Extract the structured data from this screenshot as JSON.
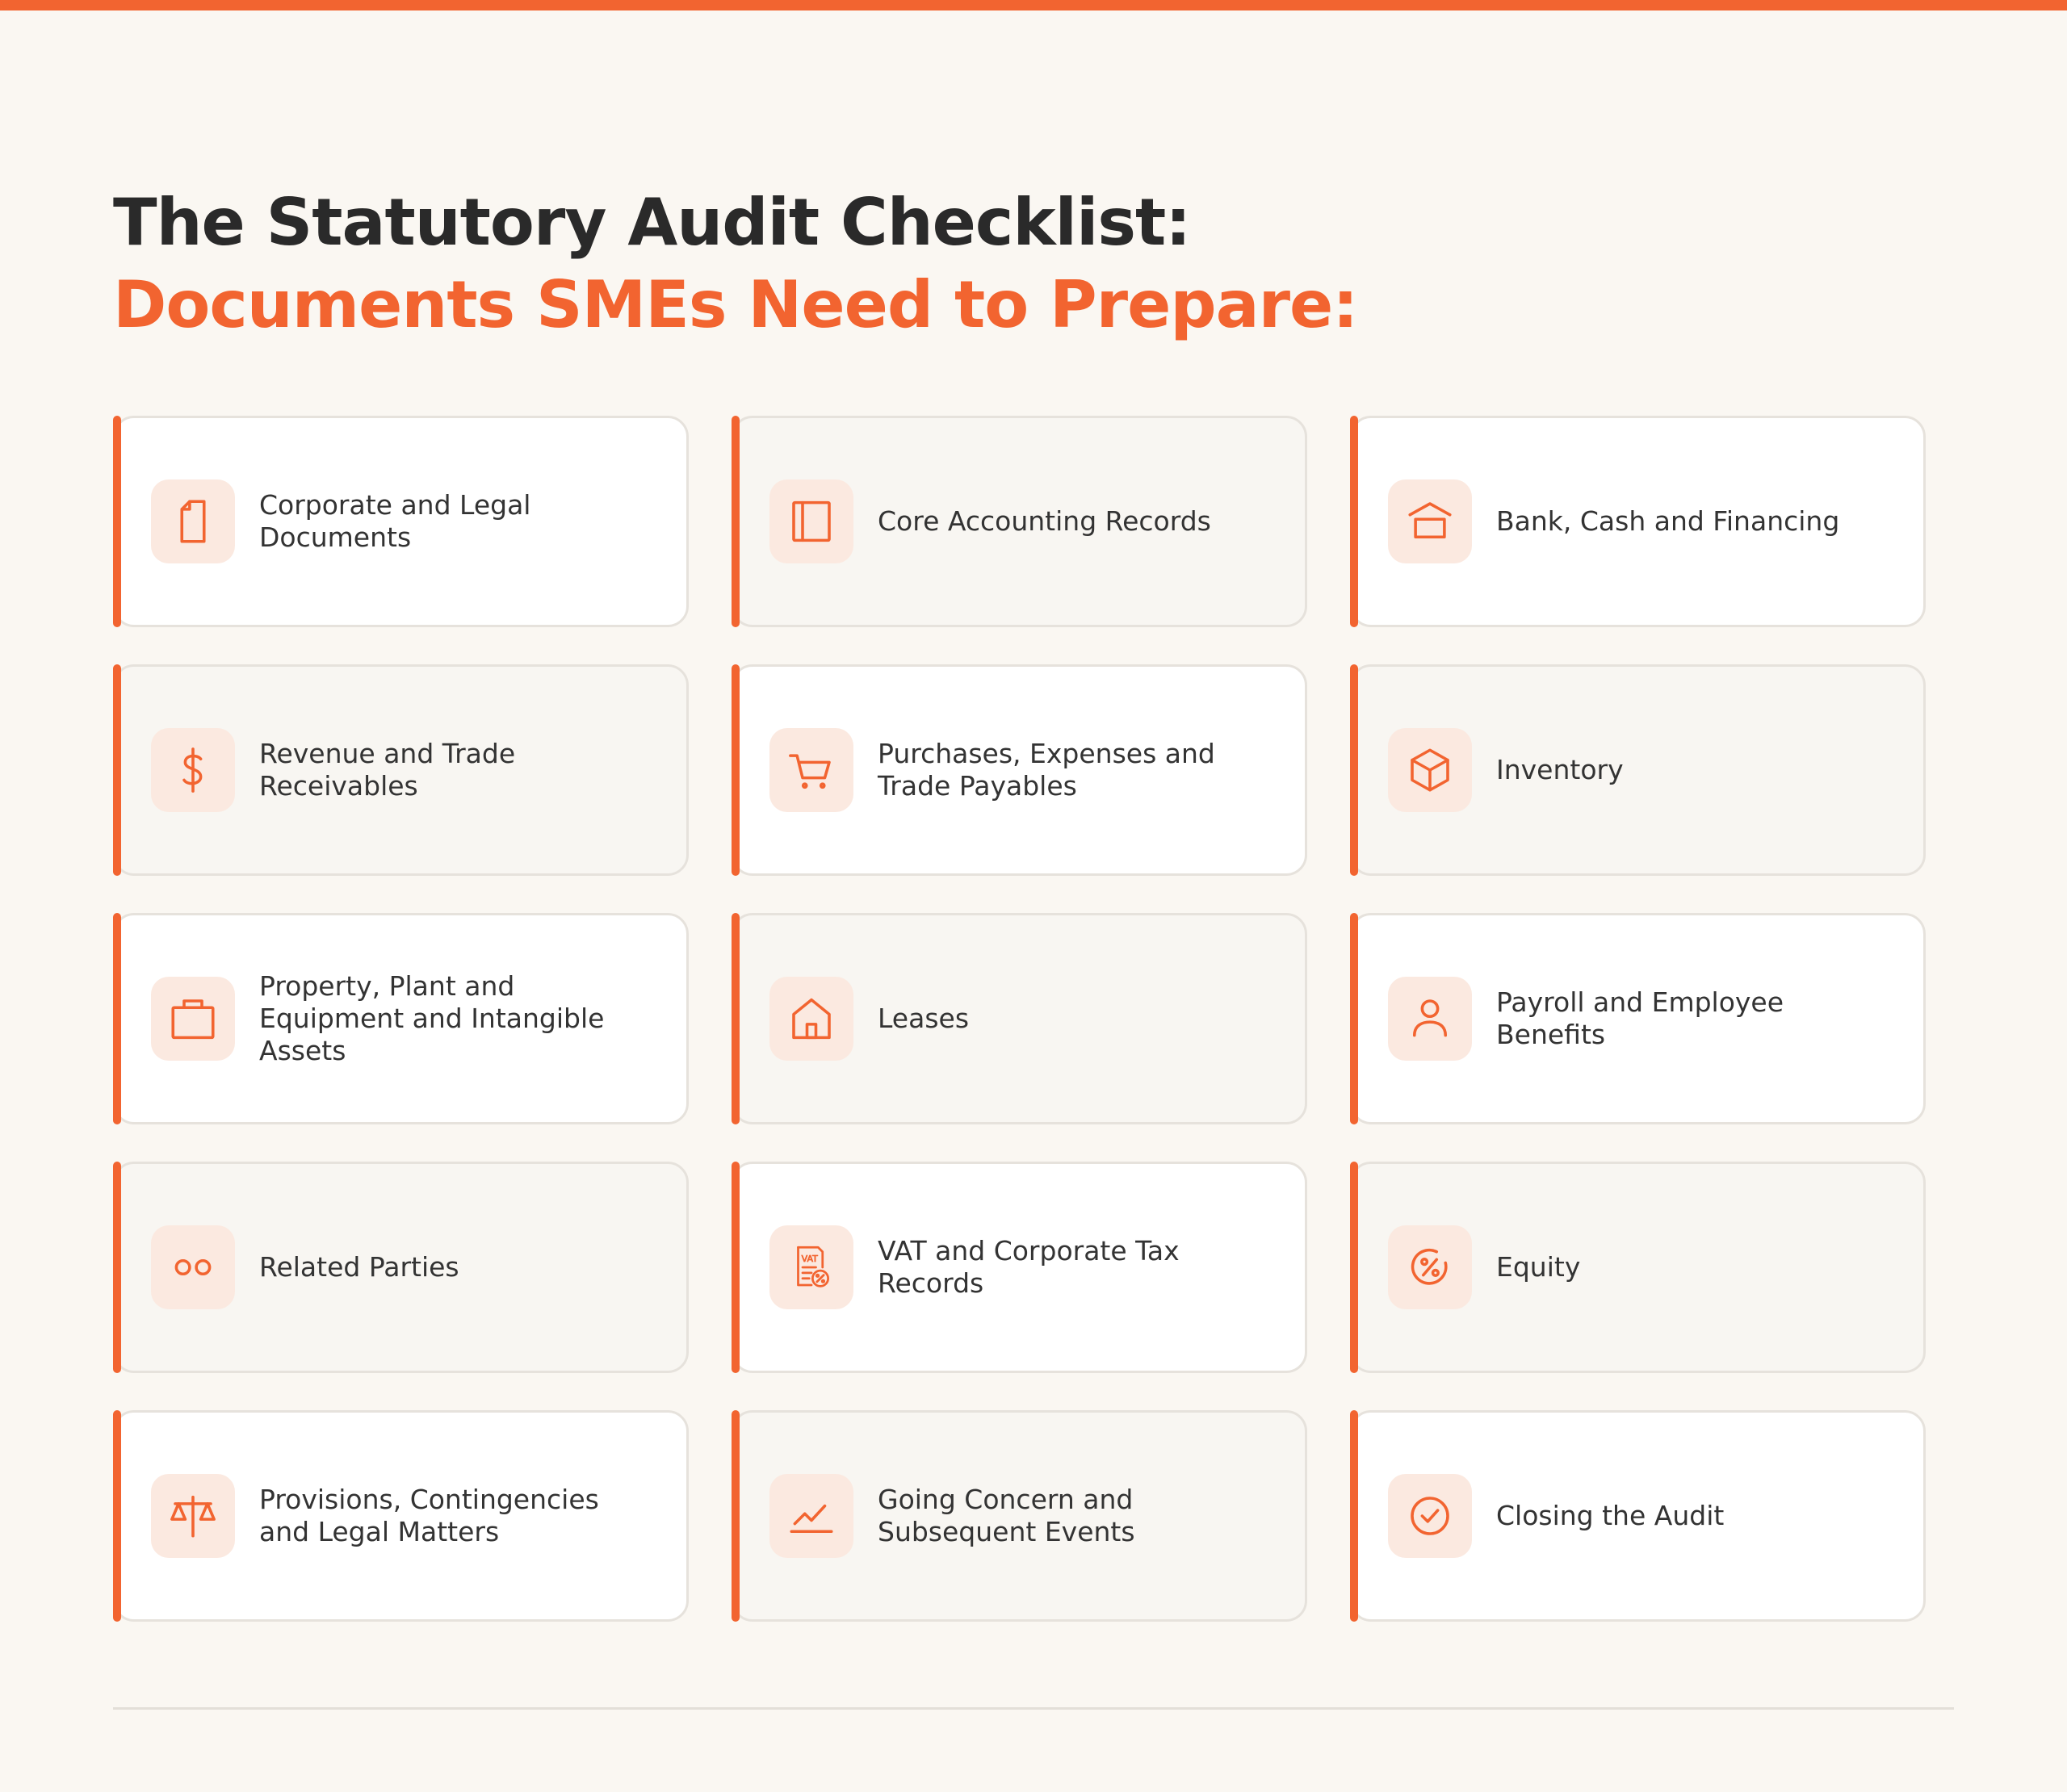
{
  "title": {
    "line1": "The Statutory Audit Checklist:",
    "line2": "Documents SMEs Need to Prepare:"
  },
  "accent_color": "#f26430",
  "cards": [
    {
      "label": "Corporate and Legal Documents",
      "icon": "document-icon"
    },
    {
      "label": "Core Accounting Records",
      "icon": "ledger-book-icon"
    },
    {
      "label": "Bank, Cash and Financing",
      "icon": "bank-icon"
    },
    {
      "label": "Revenue and Trade Receivables",
      "icon": "dollar-icon"
    },
    {
      "label": "Purchases, Expenses and Trade Payables",
      "icon": "shopping-cart-icon"
    },
    {
      "label": "Inventory",
      "icon": "box-icon"
    },
    {
      "label": "Property, Plant and Equipment and Intangible Assets",
      "icon": "briefcase-icon"
    },
    {
      "label": "Leases",
      "icon": "house-icon"
    },
    {
      "label": "Payroll and Employee Benefits",
      "icon": "user-icon"
    },
    {
      "label": "Related Parties",
      "icon": "linked-circles-icon"
    },
    {
      "label": "VAT and Corporate Tax Records",
      "icon": "vat-document-icon"
    },
    {
      "label": "Equity",
      "icon": "percent-circle-icon"
    },
    {
      "label": "Provisions, Contingencies and Legal Matters",
      "icon": "scales-icon"
    },
    {
      "label": "Going Concern and Subsequent Events",
      "icon": "trend-chart-icon"
    },
    {
      "label": "Closing the Audit",
      "icon": "check-circle-icon"
    }
  ]
}
